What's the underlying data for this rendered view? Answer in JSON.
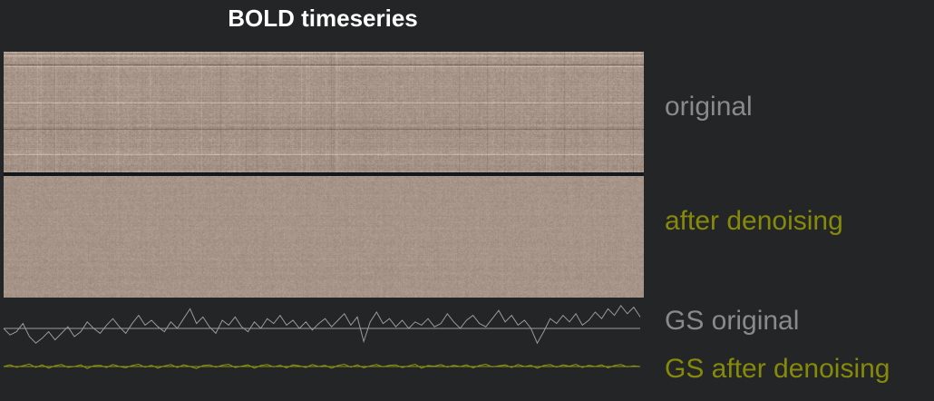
{
  "title": "BOLD timeseries",
  "labels": {
    "original": "original",
    "after_denoising": "after denoising",
    "gs_original": "GS original",
    "gs_after_denoising": "GS after denoising"
  },
  "colors": {
    "background": "#242526",
    "title": "#ffffff",
    "original_label": "#8a8a8a",
    "denoised_label": "#868a0a",
    "gs_original_line": "#9a9a9a",
    "gs_denoised_line": "#8f9410",
    "heatmap_base": "#a69488"
  },
  "chart_data": [
    {
      "type": "heatmap",
      "name": "original",
      "title": "BOLD timeseries",
      "colormap": "gray-brown",
      "grid": false,
      "legend": "none"
    },
    {
      "type": "heatmap",
      "name": "after denoising",
      "colormap": "gray-brown",
      "grid": false,
      "legend": "none"
    },
    {
      "type": "line",
      "name": "GS original",
      "values": [
        0.0,
        -0.4,
        -0.2,
        0.3,
        -0.5,
        -0.9,
        -0.6,
        -0.2,
        -0.7,
        -0.3,
        0.1,
        -0.5,
        -0.2,
        0.4,
        0.0,
        -0.3,
        0.2,
        0.6,
        0.1,
        -0.3,
        0.3,
        0.8,
        0.2,
        0.5,
        0.1,
        -0.2,
        0.4,
        0.0,
        0.6,
        1.2,
        0.3,
        0.7,
        0.1,
        -0.3,
        0.5,
        0.2,
        0.7,
        0.1,
        -0.2,
        0.4,
        0.0,
        0.6,
        0.3,
        0.8,
        0.2,
        0.5,
        0.0,
        0.4,
        -0.1,
        0.3,
        0.6,
        0.1,
        0.5,
        0.9,
        0.2,
        0.7,
        -0.8,
        0.4,
        1.0,
        0.3,
        0.6,
        0.1,
        0.5,
        0.0,
        0.4,
        0.2,
        0.6,
        0.1,
        0.3,
        0.9,
        0.4,
        0.0,
        0.5,
        0.8,
        0.3,
        0.1,
        0.6,
        1.1,
        0.4,
        0.8,
        0.2,
        0.5,
        0.0,
        -0.9,
        -0.2,
        0.6,
        0.3,
        0.8,
        0.4,
        0.9,
        0.2,
        0.5,
        1.0,
        0.6,
        1.2,
        0.8,
        1.4,
        0.9,
        1.3,
        0.7
      ],
      "baseline": 0.0,
      "grid": false,
      "legend": "none"
    },
    {
      "type": "line",
      "name": "GS after denoising",
      "values": [
        0.0,
        0.1,
        -0.05,
        0.05,
        0.15,
        -0.05,
        0.1,
        -0.1,
        0.05,
        0.12,
        -0.05,
        0.0,
        0.1,
        -0.12,
        0.05,
        0.08,
        -0.06,
        0.12,
        0.0,
        -0.08,
        0.06,
        0.14,
        -0.04,
        0.08,
        -0.1,
        0.04,
        0.12,
        -0.06,
        0.1,
        0.0,
        -0.12,
        0.06,
        0.1,
        -0.04,
        0.08,
        0.14,
        -0.06,
        0.02,
        0.1,
        -0.1,
        0.06,
        0.12,
        -0.02,
        0.08,
        -0.08,
        0.1,
        0.04,
        -0.06,
        0.12,
        0.0,
        0.08,
        -0.1,
        0.06,
        0.14,
        -0.04,
        0.1,
        -0.08,
        0.04,
        0.12,
        -0.02,
        0.08,
        0.1,
        -0.06,
        0.04,
        0.14,
        -0.1,
        0.06,
        0.02,
        0.12,
        -0.04,
        0.08,
        0.0,
        0.1,
        -0.08,
        0.06,
        0.14,
        -0.02,
        0.04,
        0.1,
        -0.06,
        0.12,
        0.0,
        0.08,
        -0.1,
        0.06,
        0.12,
        -0.04,
        0.1,
        0.02,
        0.14,
        -0.06,
        0.08,
        0.0,
        0.1,
        -0.08,
        0.06,
        0.12,
        -0.02,
        0.04,
        0.0
      ],
      "baseline": 0.0,
      "grid": false,
      "legend": "none"
    }
  ]
}
